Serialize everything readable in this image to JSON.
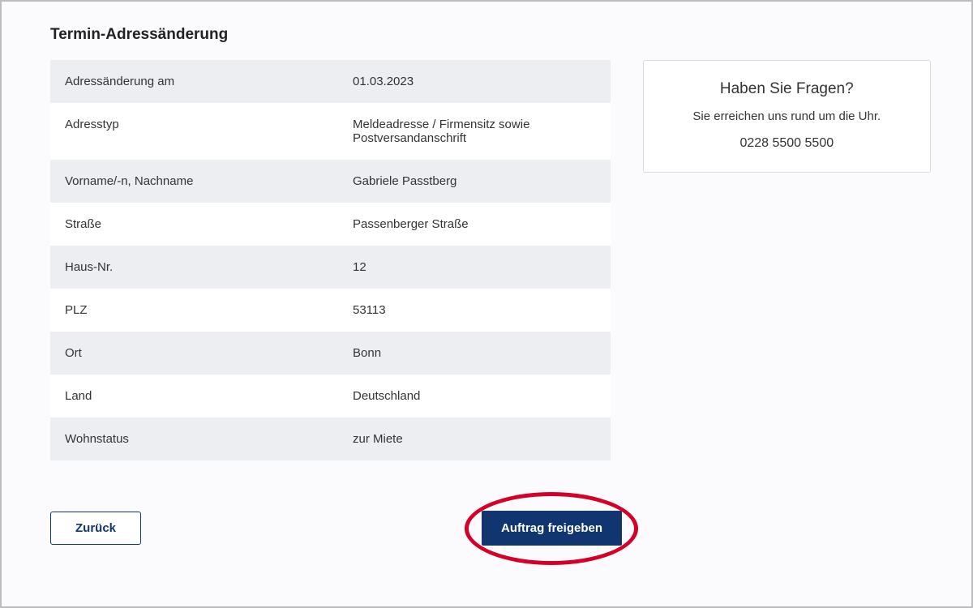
{
  "page": {
    "title": "Termin-Adressänderung"
  },
  "rows": [
    {
      "label": "Adressänderung am",
      "value": "01.03.2023"
    },
    {
      "label": "Adresstyp",
      "value": "Meldeadresse / Firmensitz sowie Postversandanschrift"
    },
    {
      "label": "Vorname/-n, Nachname",
      "value": "Gabriele Passtberg"
    },
    {
      "label": "Straße",
      "value": "Passenberger Straße"
    },
    {
      "label": "Haus-Nr.",
      "value": "12"
    },
    {
      "label": "PLZ",
      "value": "53113"
    },
    {
      "label": "Ort",
      "value": "Bonn"
    },
    {
      "label": "Land",
      "value": "Deutschland"
    },
    {
      "label": "Wohnstatus",
      "value": "zur Miete"
    }
  ],
  "sidebar": {
    "title": "Haben Sie Fragen?",
    "subtitle": "Sie erreichen uns rund um die Uhr.",
    "phone": "0228 5500 5500"
  },
  "actions": {
    "back": "Zurück",
    "submit": "Auftrag freigeben"
  }
}
